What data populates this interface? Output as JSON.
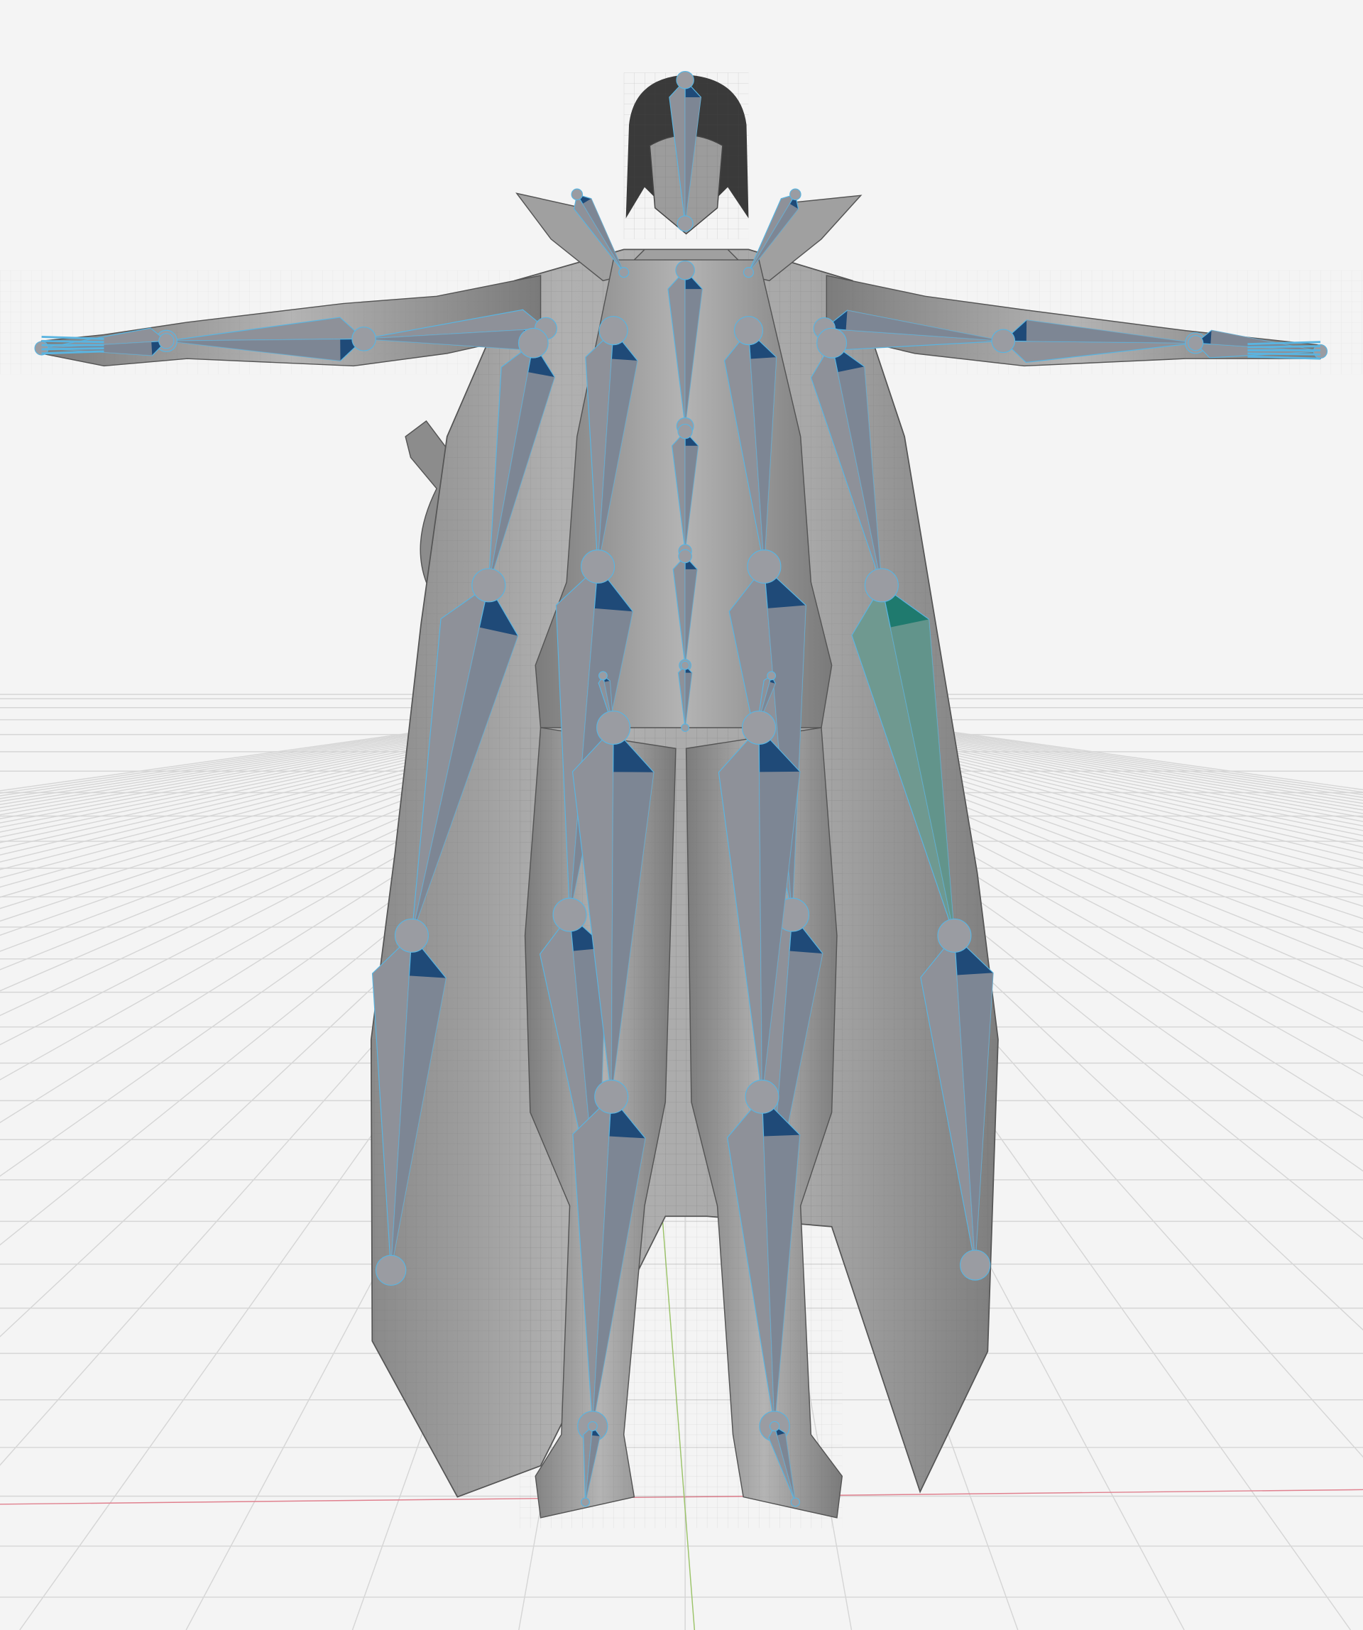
{
  "scene": {
    "colors": {
      "background": "#f4f4f4",
      "grid": "#d6d6d6",
      "x_axis": "#e0808e",
      "y_axis": "#9cc46a",
      "mesh": "#9a9a9a",
      "mesh_dark": "#6e6e6e",
      "bone": "#8e9199",
      "bone_edge": "#5ab4e0",
      "bone_shadow": "#1f4a78",
      "bone_active": "#6f9990",
      "bone_active_shadow": "#1f7a6e",
      "hair": "#3a3a3a"
    }
  }
}
